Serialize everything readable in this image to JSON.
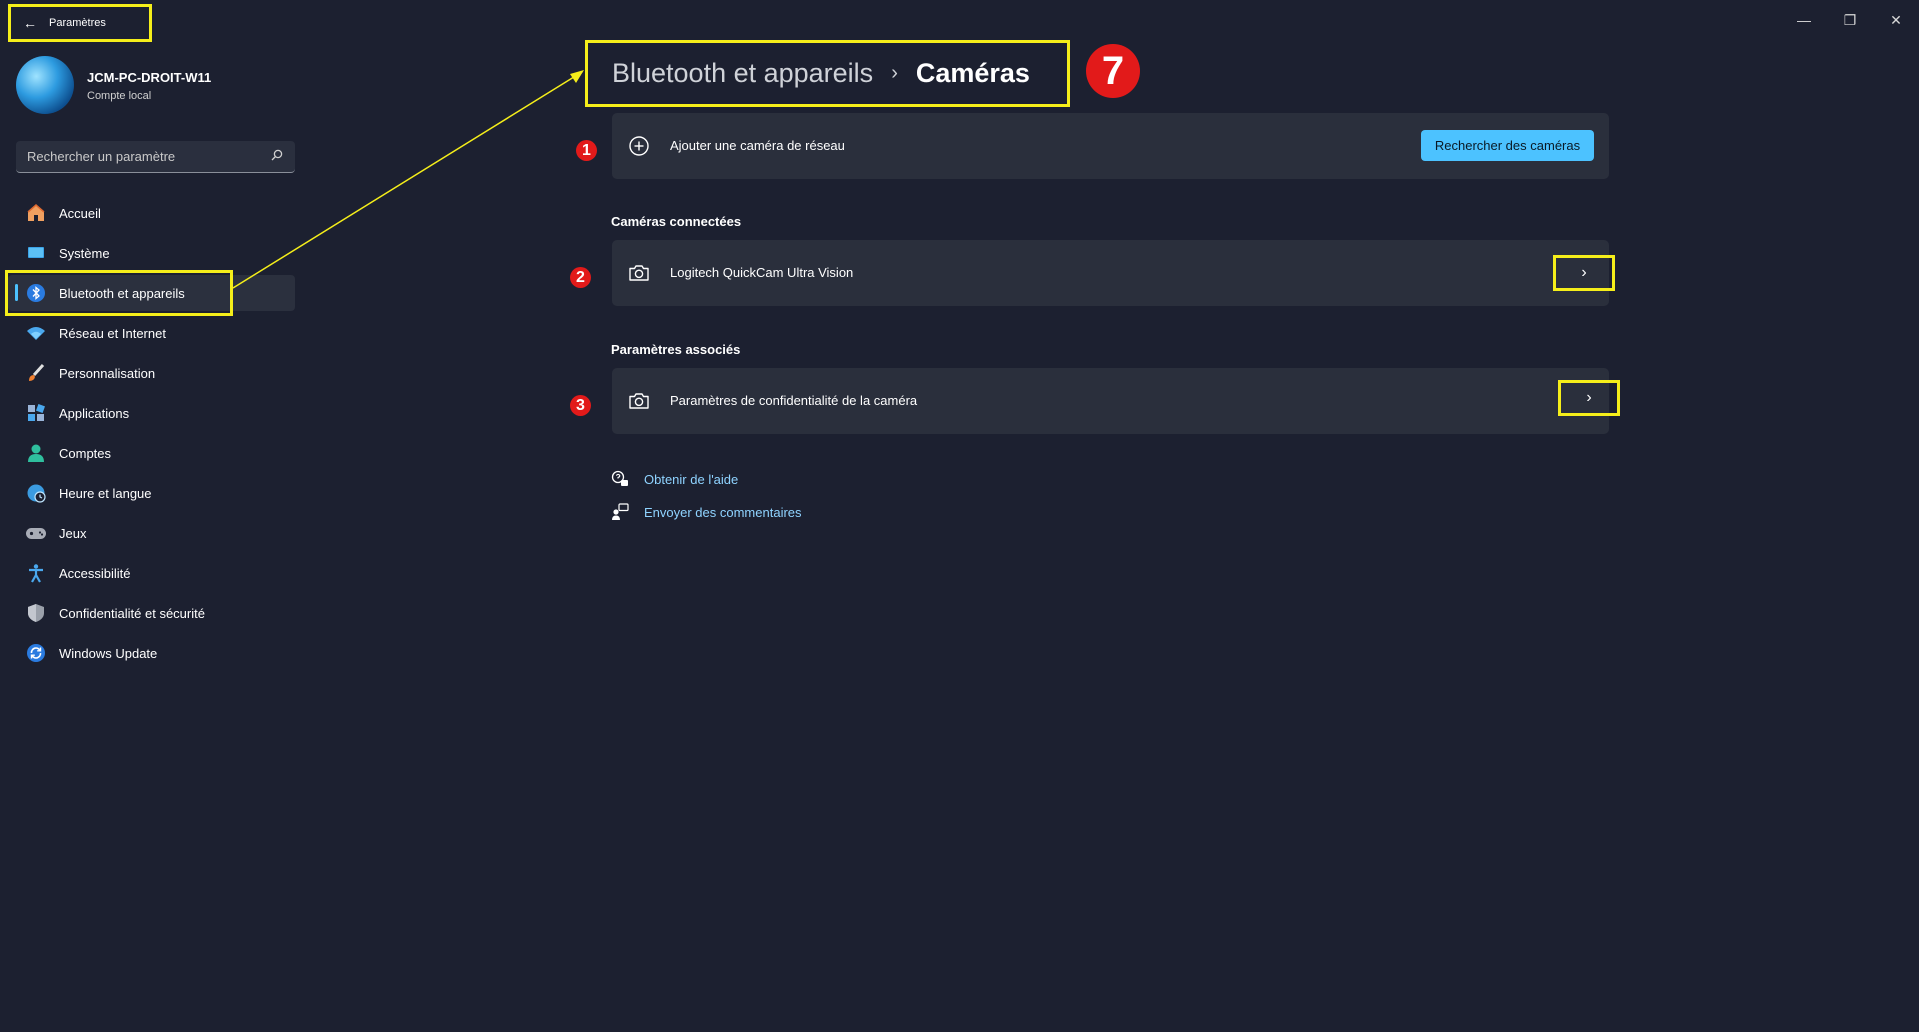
{
  "window": {
    "title": "Paramètres",
    "back_icon": "arrow-left-icon",
    "controls": {
      "minimize": "—",
      "maximize": "❐",
      "close": "✕"
    }
  },
  "user": {
    "name": "JCM-PC-DROIT-W11",
    "account_type": "Compte local"
  },
  "search": {
    "placeholder": "Rechercher un paramètre",
    "icon": "search-icon"
  },
  "sidebar": {
    "items": [
      {
        "label": "Accueil",
        "icon": "home-icon",
        "active": false
      },
      {
        "label": "Système",
        "icon": "system-icon",
        "active": false
      },
      {
        "label": "Bluetooth et appareils",
        "icon": "bluetooth-icon",
        "active": true
      },
      {
        "label": "Réseau et Internet",
        "icon": "wifi-icon",
        "active": false
      },
      {
        "label": "Personnalisation",
        "icon": "brush-icon",
        "active": false
      },
      {
        "label": "Applications",
        "icon": "apps-icon",
        "active": false
      },
      {
        "label": "Comptes",
        "icon": "account-icon",
        "active": false
      },
      {
        "label": "Heure et langue",
        "icon": "globe-clock-icon",
        "active": false
      },
      {
        "label": "Jeux",
        "icon": "gamepad-icon",
        "active": false
      },
      {
        "label": "Accessibilité",
        "icon": "accessibility-icon",
        "active": false
      },
      {
        "label": "Confidentialité et sécurité",
        "icon": "shield-icon",
        "active": false
      },
      {
        "label": "Windows Update",
        "icon": "update-icon",
        "active": false
      }
    ]
  },
  "breadcrumb": {
    "parent": "Bluetooth et appareils",
    "separator": "›",
    "current": "Caméras"
  },
  "annotations": {
    "big_badge": "7",
    "badge_1": "1",
    "badge_2": "2",
    "badge_3": "3"
  },
  "add_camera": {
    "label": "Ajouter une caméra de réseau",
    "icon": "add-circle-icon",
    "button_label": "Rechercher des caméras"
  },
  "connected": {
    "section_title": "Caméras connectées",
    "camera_name": "Logitech QuickCam Ultra Vision",
    "icon": "camera-icon",
    "chevron": "›"
  },
  "related": {
    "section_title": "Paramètres associés",
    "label": "Paramètres de confidentialité de la caméra",
    "icon": "camera-icon",
    "chevron": "›"
  },
  "links": {
    "help": "Obtenir de l'aide",
    "feedback": "Envoyer des commentaires"
  },
  "colors": {
    "background": "#1c2030",
    "card": "#2a2f3c",
    "accent": "#4cc2ff",
    "annotation_yellow": "#f5ee1a",
    "annotation_red": "#e21a1a"
  }
}
